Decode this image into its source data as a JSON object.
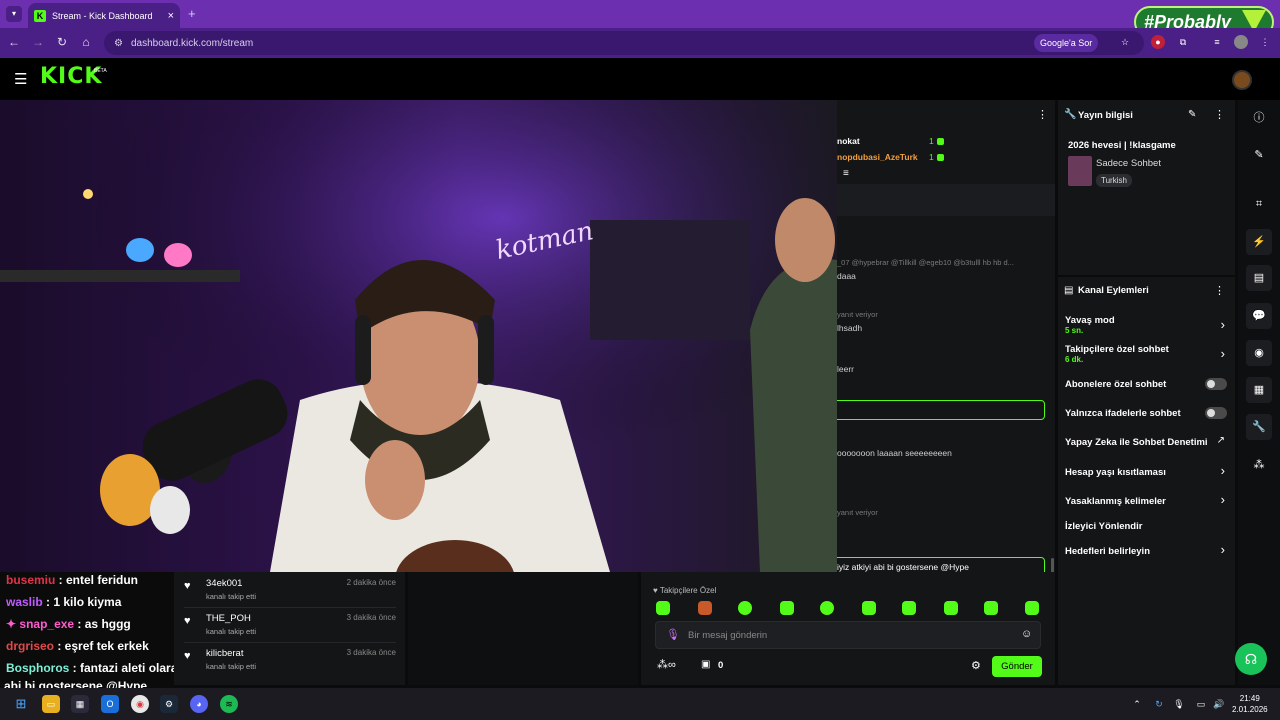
{
  "browser": {
    "tab_title": "Stream - Kick Dashboard",
    "tab_close": "×",
    "new_tab": "+",
    "url": "dashboard.kick.com/stream",
    "google_button": "Google'a Sor",
    "watermark": "#Probably"
  },
  "kick": {
    "logo": "KICK",
    "beta": "BETA"
  },
  "chat_panel": {
    "users": [
      {
        "name": "nokat",
        "count": "1"
      },
      {
        "name": "nopdubasi_AzeTurk",
        "count": "1"
      }
    ],
    "lines": [
      {
        "text": "_07 @hypebrar @Tillkill @egeb10 @b3tulll hb hb d...",
        "muted": true
      },
      {
        "text": "daaa",
        "muted": false
      },
      {
        "text": "yanıt veriyor",
        "muted": true
      },
      {
        "text": "lhsadh",
        "muted": false
      },
      {
        "text": "leerr",
        "muted": false
      },
      {
        "text": "ooooooon laaaan seeeeeeeen",
        "muted": false
      },
      {
        "text": "yanıt veriyor",
        "muted": true
      }
    ],
    "highlight_line": "iyiz atkiyi abi bi gostersene @Hype"
  },
  "stream_info": {
    "header": "Yayın bilgisi",
    "title": "2026 hevesi | !klasgame",
    "category": "Sadece Sohbet",
    "language": "Turkish"
  },
  "channel_actions": {
    "header": "Kanal Eylemleri",
    "items": [
      {
        "label": "Yavaş mod",
        "sub": "5 sn.",
        "control": "chevron"
      },
      {
        "label": "Takipçilere özel sohbet",
        "sub": "6 dk.",
        "control": "chevron"
      },
      {
        "label": "Abonelere özel sohbet",
        "sub": "",
        "control": "toggle"
      },
      {
        "label": "Yalnızca ifadelerle sohbet",
        "sub": "",
        "control": "toggle"
      },
      {
        "label": "Yapay Zeka ile Sohbet Denetimi",
        "sub": "",
        "control": "external"
      },
      {
        "label": "Hesap yaşı kısıtlaması",
        "sub": "",
        "control": "chevron"
      },
      {
        "label": "Yasaklanmış kelimeler",
        "sub": "",
        "control": "chevron"
      },
      {
        "label": "İzleyici Yönlendir",
        "sub": "",
        "control": "none"
      },
      {
        "label": "Hedefleri belirleyin",
        "sub": "",
        "control": "chevron"
      }
    ]
  },
  "overlay_chat": [
    {
      "user": "busemiu",
      "msg": " : entel feridun",
      "color": "#e0334a"
    },
    {
      "user": "waslib",
      "msg": " : 1 kilo kiyma",
      "color": "#c25bff"
    },
    {
      "user": "snap_exe",
      "msg": " : as hggg",
      "color": "#ff5ad0"
    },
    {
      "user": "drgriseo",
      "msg": " : eşref tek erkek",
      "color": "#e04a4a"
    },
    {
      "user": "Bosphoros",
      "msg": " : fantazi aleti olarak kullanabilir miyiz atkiyi",
      "color": "#7df0d8"
    },
    {
      "user": "",
      "msg": "abi bi gostersene @Hype",
      "color": "#ffffff"
    }
  ],
  "followers": [
    {
      "name": "34ek001",
      "action": "kanalı takip etti",
      "time": "2 dakika önce"
    },
    {
      "name": "THE_POH",
      "action": "kanalı takip etti",
      "time": "3 dakika önce"
    },
    {
      "name": "kilicberat",
      "action": "kanalı takip etti",
      "time": "3 dakika önce"
    }
  ],
  "chat_bottom": {
    "emote_section": "Takipçilere Özel",
    "placeholder": "Bir mesaj gönderin",
    "count": "0",
    "send": "Gönder"
  },
  "taskbar": {
    "time": "21:49",
    "date": "2.01.2026"
  },
  "colors": {
    "brand": "#53fc18",
    "chrome": "#4a1f86"
  }
}
